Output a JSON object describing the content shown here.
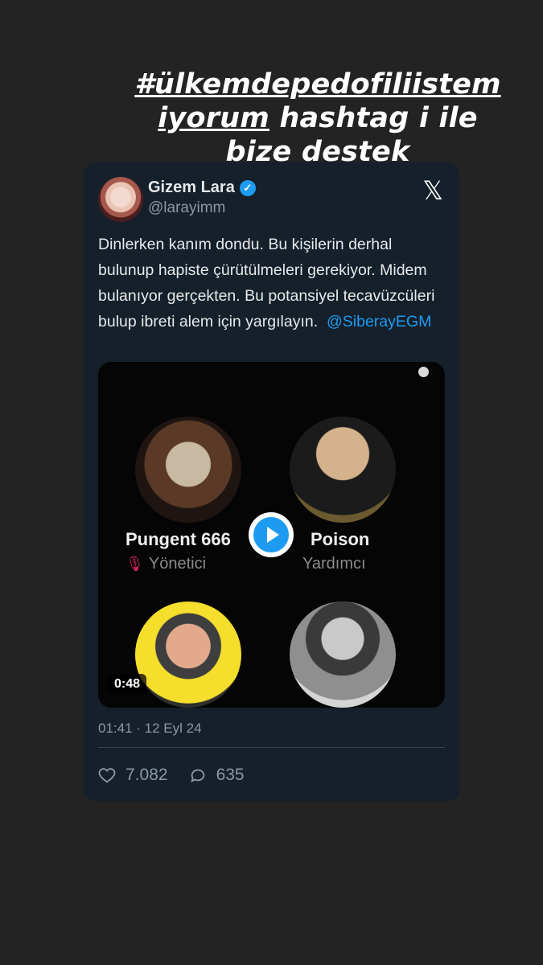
{
  "caption": {
    "hashtag_line1": "#ülkemdepedofiliistem",
    "hashtag_line2": "iyorum",
    "rest_line2": " hashtag i ile",
    "line3": "bize destek olabilirsiniz"
  },
  "tweet": {
    "author_name": "Gizem Lara",
    "handle": "@larayimm",
    "text": "Dinlerken kanım dondu. Bu kişilerin derhal bulunup hapiste çürütülmeleri gerekiyor. Midem bulanıyor gerçekten. Bu potansiyel tecavüzcüleri bulup ibreti alem için yargılayın.",
    "mention": "@SiberayEGM",
    "timestamp": "01:41 · 12 Eyl 24",
    "likes": "7.082",
    "replies": "635"
  },
  "media": {
    "user1_name": "Pungent 666",
    "user1_role": "Yönetici",
    "user2_name": "Poison",
    "user2_role": "Yardımcı",
    "duration": "0:48"
  },
  "colors": {
    "accent": "#1d9bf0",
    "card_bg": "#15202b",
    "page_bg": "#232323"
  }
}
